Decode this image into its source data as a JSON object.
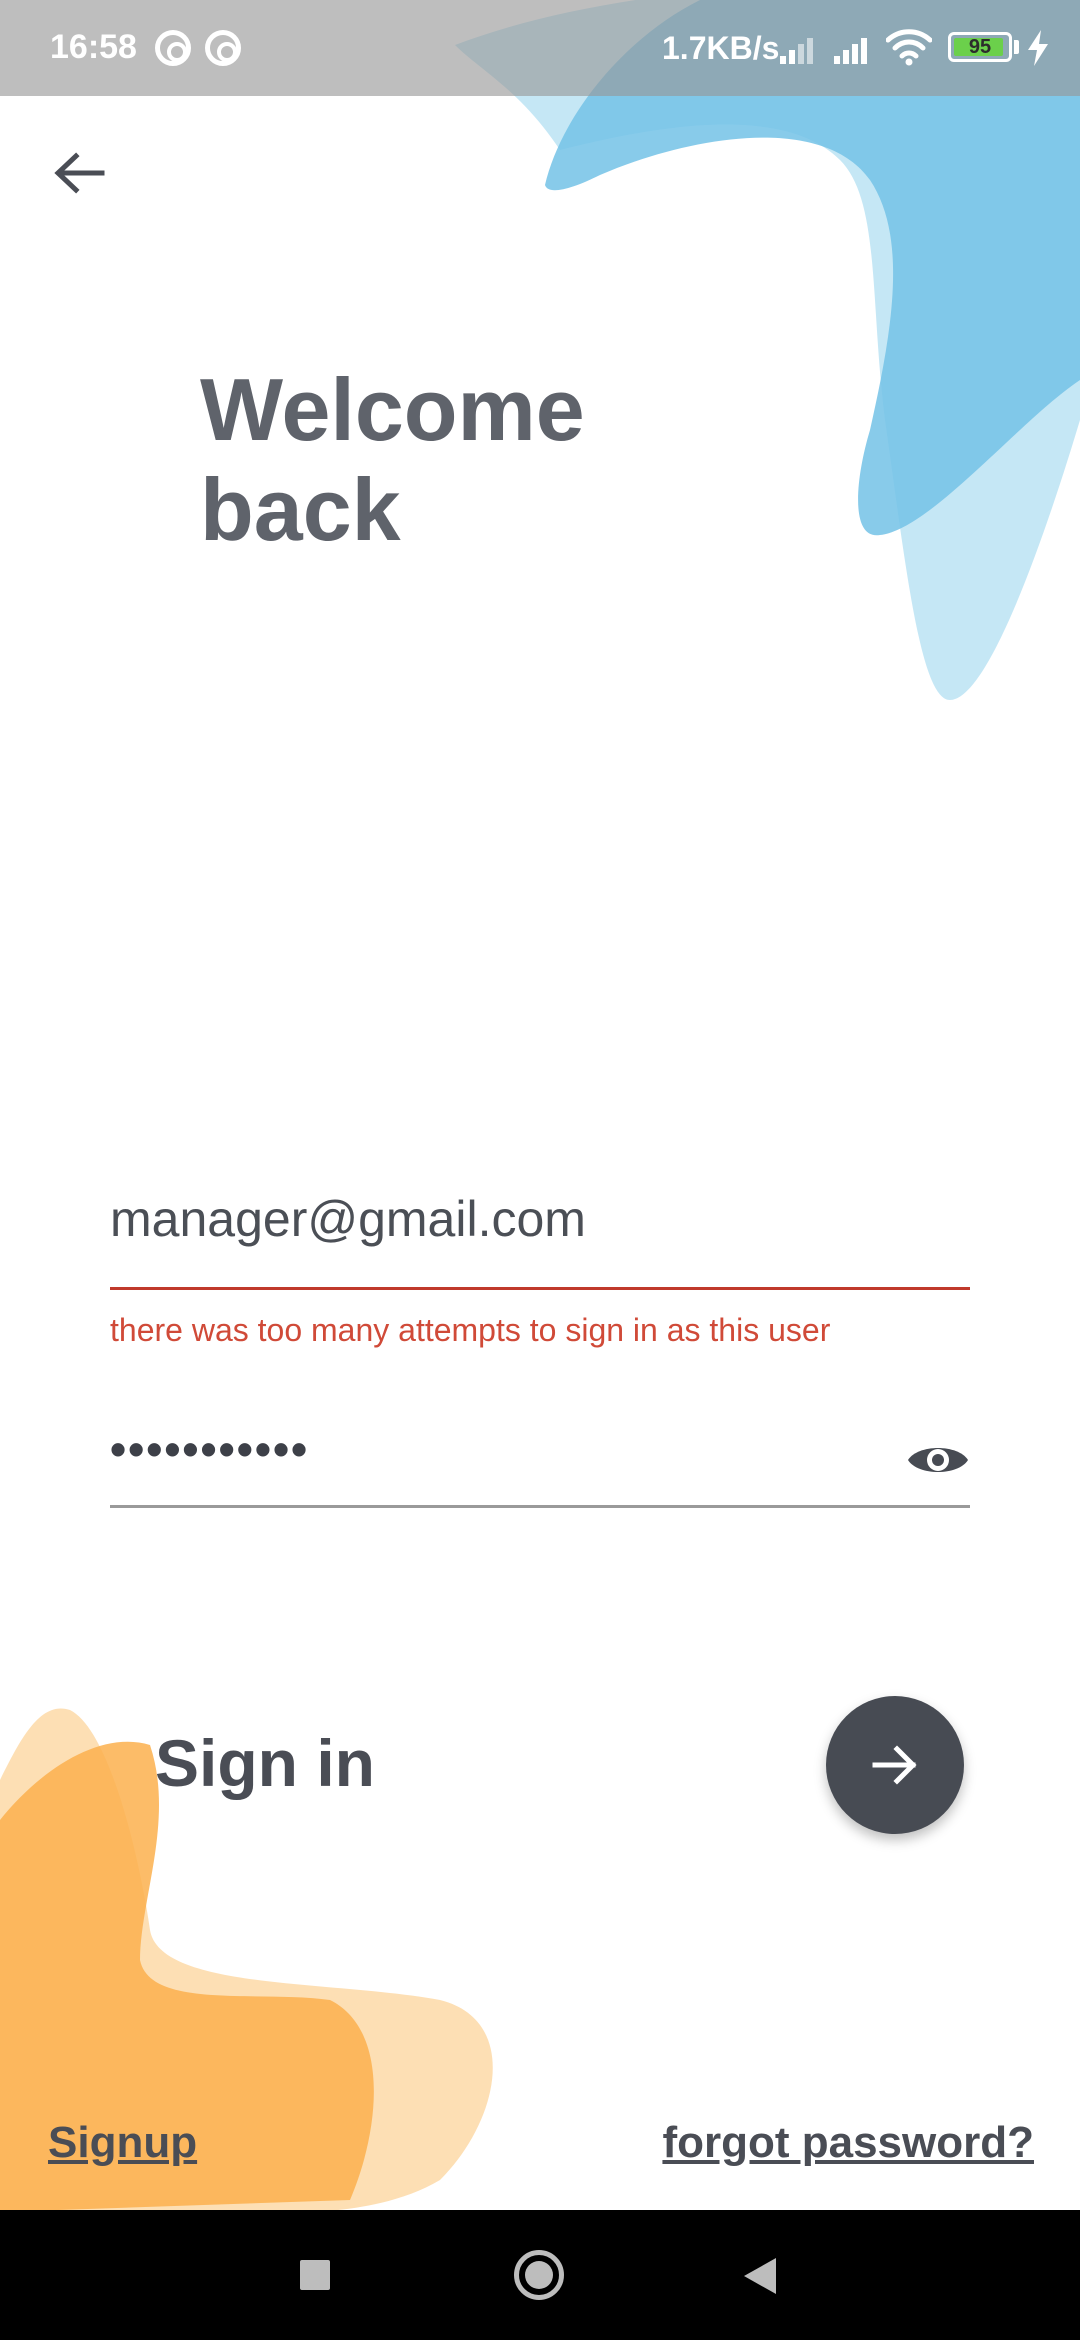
{
  "status_bar": {
    "time": "16:58",
    "net_speed": "1.7KB/s",
    "battery_level": "95",
    "battery_fraction": 0.95,
    "icons": [
      "at-icon",
      "at-icon",
      "signal-icon",
      "signal-icon",
      "wifi-icon",
      "battery-icon",
      "charging-bolt-icon"
    ]
  },
  "header": {
    "back_icon": "arrow-left-icon"
  },
  "title": {
    "line1": "Welcome",
    "line2": "back"
  },
  "form": {
    "email_value": "manager@gmail.com",
    "email_error": "there was too many attempts to sign in as this user",
    "password_masked": "•••••••••••",
    "password_toggle_icon": "eye-icon"
  },
  "sign_in": {
    "label": "Sign in",
    "button_icon": "arrow-right-icon"
  },
  "links": {
    "signup": "Signup",
    "forgot_password": "forgot password?"
  },
  "colors": {
    "error": "#d04a38",
    "button": "#474b53",
    "blue_blob": "#7cc8e8",
    "orange_blob": "#fbb04e"
  }
}
